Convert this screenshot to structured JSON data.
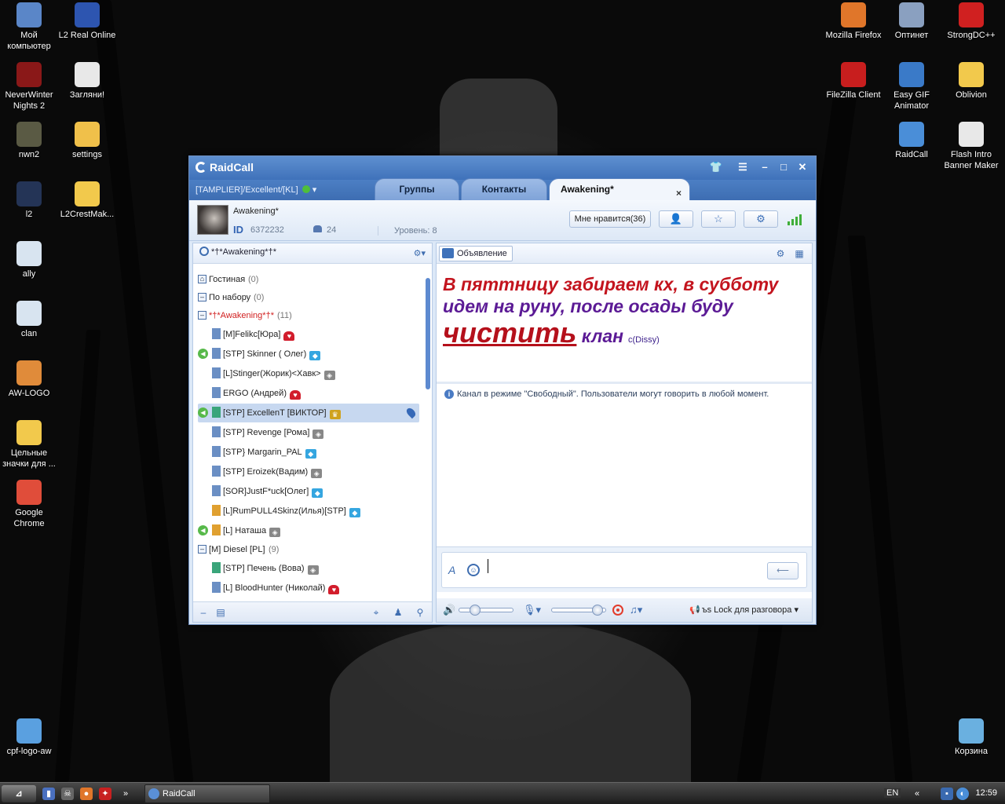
{
  "desktop": {
    "icons_left": [
      {
        "label": "Мой компьютер",
        "icon": "computer-icon",
        "color": "#5a86c8"
      },
      {
        "label": "L2 Real Online",
        "icon": "gear-settings-icon",
        "color": "#2d55b0"
      },
      {
        "label": "NeverWinter Nights 2",
        "icon": "nwn2-icon",
        "color": "#8a1818"
      },
      {
        "label": "Загляни!",
        "icon": "text-file-icon",
        "color": "#e8e8e8"
      },
      {
        "label": "nwn2",
        "icon": "skull-icon",
        "color": "#5a5a44"
      },
      {
        "label": "settings",
        "icon": "config-file-icon",
        "color": "#f0c04a"
      },
      {
        "label": "l2",
        "icon": "lineage-icon",
        "color": "#243456"
      },
      {
        "label": "L2CrestMak...",
        "icon": "folder-icon",
        "color": "#f2c94c"
      },
      {
        "label": "ally",
        "icon": "image-pen-icon",
        "color": "#d8e4f0"
      },
      {
        "label": "clan",
        "icon": "image-pen-icon",
        "color": "#d8e4f0"
      },
      {
        "label": "AW-LOGO",
        "icon": "image-icon",
        "color": "#e08b3a"
      },
      {
        "label": "Цельные значки для ...",
        "icon": "folder-icon",
        "color": "#f2c94c"
      },
      {
        "label": "Google Chrome",
        "icon": "chrome-icon",
        "color": "#e04d3a"
      },
      {
        "label": "cpf-logo-aw",
        "icon": "image-file-icon",
        "color": "#5aa0e0"
      }
    ],
    "icons_right": [
      {
        "label": "Mozilla Firefox",
        "icon": "firefox-icon",
        "color": "#e0762a"
      },
      {
        "label": "Оптинет",
        "icon": "network-icon",
        "color": "#8aa0c0"
      },
      {
        "label": "StrongDC++",
        "icon": "strongdc-icon",
        "color": "#d02020"
      },
      {
        "label": "FileZilla Client",
        "icon": "filezilla-icon",
        "color": "#c81e1e"
      },
      {
        "label": "Easy GIF Animator",
        "icon": "gif-animator-icon",
        "color": "#3a7ac8"
      },
      {
        "label": "Oblivion",
        "icon": "folder-icon",
        "color": "#f2c94c"
      },
      {
        "label": "RaidCall",
        "icon": "raidcall-icon",
        "color": "#4a8ed8"
      },
      {
        "label": "Flash Intro Banner Maker",
        "icon": "pen-file-icon",
        "color": "#e8e8e8"
      },
      {
        "label": "Корзина",
        "icon": "recycle-bin-icon",
        "color": "#6ab0e0"
      }
    ]
  },
  "taskbar": {
    "task_label": "RaidCall",
    "lang": "EN",
    "clock": "12:59"
  },
  "window": {
    "app_name": "RaidCall",
    "user_path": "[TAMPLIER]/Excellent/[KL]",
    "tabs": [
      {
        "label": "Группы"
      },
      {
        "label": "Контакты"
      },
      {
        "label": "Awakening*"
      }
    ],
    "tab_close": "×",
    "channel": {
      "name": "Awakening*",
      "id_label": "ID",
      "id": "6372232",
      "users": "24",
      "level": "Уровень: 8",
      "like_button": "Мне нравится(36)"
    },
    "left": {
      "channel_title": "*†*Awakening*†*",
      "rows": [
        {
          "type": "group",
          "label": "Гостиная",
          "count": "(0)",
          "box": "⌂",
          "color": "#222"
        },
        {
          "type": "group",
          "label": "По набору",
          "count": "(0)",
          "box": "–",
          "color": "#222"
        },
        {
          "type": "group",
          "label": "*†*Awakening*†*",
          "count": "(11)",
          "box": "–",
          "color": "#d12020"
        },
        {
          "type": "user",
          "label": "[M]Felikc[Юра]",
          "badge": "heart",
          "speaking": false,
          "sel": false,
          "user_color": "#6b8fc4"
        },
        {
          "type": "user",
          "label": "[STP] Skinner ( Олег)",
          "badge": "dia",
          "speaking": true,
          "sel": false,
          "user_color": "#6b8fc4"
        },
        {
          "type": "user",
          "label": "[L]Stinger(Жорик)<Хавк>",
          "badge": "emb",
          "speaking": false,
          "sel": false,
          "user_color": "#6b8fc4"
        },
        {
          "type": "user",
          "label": "ERGO (Андрей)",
          "badge": "heart",
          "speaking": false,
          "sel": false,
          "user_color": "#6b8fc4"
        },
        {
          "type": "user",
          "label": "[STP] ExcellenT [ВИКТОР]",
          "badge": "crown",
          "speaking": true,
          "sel": true,
          "user_color": "#3aa57a"
        },
        {
          "type": "user",
          "label": "[STP] Revenge [Рома]",
          "badge": "emb",
          "speaking": false,
          "sel": false,
          "user_color": "#6b8fc4"
        },
        {
          "type": "user",
          "label": "[STP} Margarin_PAL",
          "badge": "dia",
          "speaking": false,
          "sel": false,
          "user_color": "#6b8fc4"
        },
        {
          "type": "user",
          "label": "[STP] Eroizek(Вадим)",
          "badge": "emb",
          "speaking": false,
          "sel": false,
          "user_color": "#6b8fc4"
        },
        {
          "type": "user",
          "label": "[SOR]JustF*uck[Олег]",
          "badge": "dia",
          "speaking": false,
          "sel": false,
          "user_color": "#6b8fc4"
        },
        {
          "type": "user",
          "label": "[L]RumPULL4Skinz(Илья)[STP]",
          "badge": "dia",
          "speaking": false,
          "sel": false,
          "user_color": "#e0a030"
        },
        {
          "type": "user",
          "label": "[L] Наташа",
          "badge": "emb",
          "speaking": true,
          "sel": false,
          "user_color": "#e0a030"
        },
        {
          "type": "group",
          "label": "[M] Diesel [PL]",
          "count": "(9)",
          "box": "–",
          "color": "#222"
        },
        {
          "type": "user",
          "label": "[STP] Печень (Вова)",
          "badge": "emb",
          "speaking": false,
          "sel": false,
          "user_color": "#3aa57a"
        },
        {
          "type": "user",
          "label": "[L] BloodHunter (Николай)",
          "badge": "heart",
          "speaking": false,
          "sel": false,
          "user_color": "#6b8fc4"
        }
      ]
    },
    "right": {
      "announcement_button": "Объявление",
      "announcement": {
        "p1": "В пяттницу ",
        "p2": "забираем кх, в субботу",
        "p3": "идем на руну, после осады ",
        "p4": "буду",
        "p5": "чистить",
        "p6": " клан",
        "sig": "c(Dissy)"
      },
      "info": "Канал в режиме \"Свободный\". Пользователи могут говорить в любой момент.",
      "font_icon": "A",
      "send_icon": "⟵",
      "voice_mode": "ъs Lock для разговора",
      "volume_level": 0.3,
      "mic_level": 0.85
    }
  }
}
